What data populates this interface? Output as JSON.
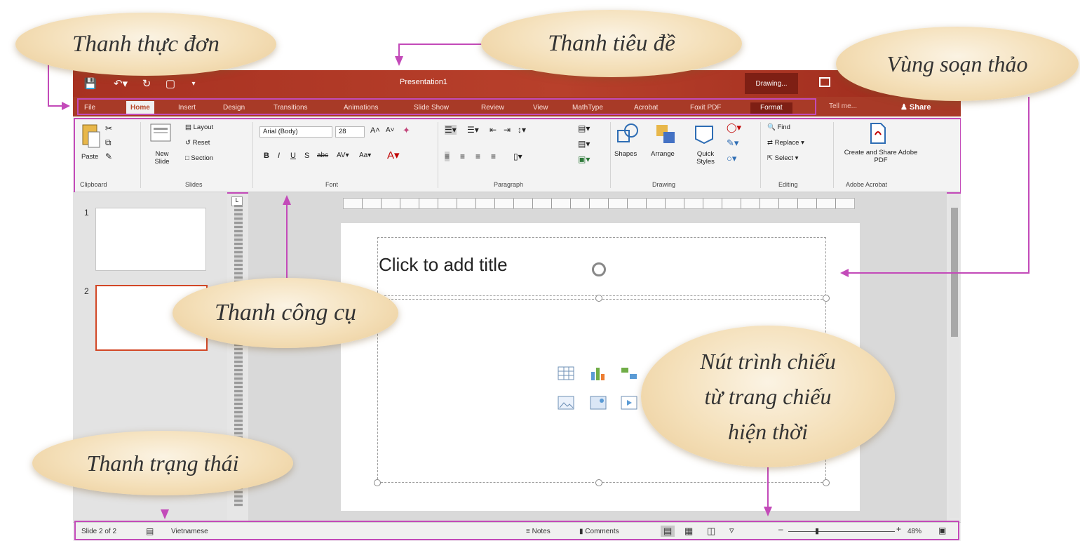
{
  "window": {
    "doc_title": "Presentation1",
    "contextual_title": "Drawing...",
    "tabs": [
      "File",
      "Home",
      "Insert",
      "Design",
      "Transitions",
      "Animations",
      "Slide Show",
      "Review",
      "View",
      "MathType",
      "Acrobat",
      "Foxit PDF",
      "Format"
    ],
    "tell_me": "Tell me...",
    "share": "Share"
  },
  "ribbon": {
    "groups": [
      "Clipboard",
      "Slides",
      "Font",
      "Paragraph",
      "Drawing",
      "Editing",
      "Adobe Acrobat"
    ],
    "paste": "Paste",
    "new_slide": "New Slide",
    "layout": "Layout",
    "reset": "Reset",
    "section": "Section",
    "font_name": "Arial (Body)",
    "font_size": "28",
    "shapes": "Shapes",
    "arrange": "Arrange",
    "quick_styles": "Quick Styles",
    "find": "Find",
    "replace": "Replace",
    "select": "Select",
    "create_share": "Create and Share Adobe PDF"
  },
  "slides_panel": {
    "numbers": [
      "1",
      "2"
    ]
  },
  "slide": {
    "title_placeholder": "Click to add title"
  },
  "status": {
    "slide_info": "Slide 2 of 2",
    "language": "Vietnamese",
    "notes": "Notes",
    "comments": "Comments",
    "zoom": "48%"
  },
  "callouts": {
    "menu_bar": "Thanh thực đơn",
    "title_bar": "Thanh tiêu đề",
    "editing_area": "Vùng soạn thảo",
    "toolbar": "Thanh công cụ",
    "status_bar": "Thanh trạng thái",
    "slideshow_line1": "Nút trình chiếu",
    "slideshow_line2": "từ trang chiếu",
    "slideshow_line3": "hiện thời"
  },
  "colors": {
    "powerpoint_red": "#b7472a",
    "annotation_magenta": "#c34ab9",
    "callout_fill": "#f4dfb8"
  }
}
